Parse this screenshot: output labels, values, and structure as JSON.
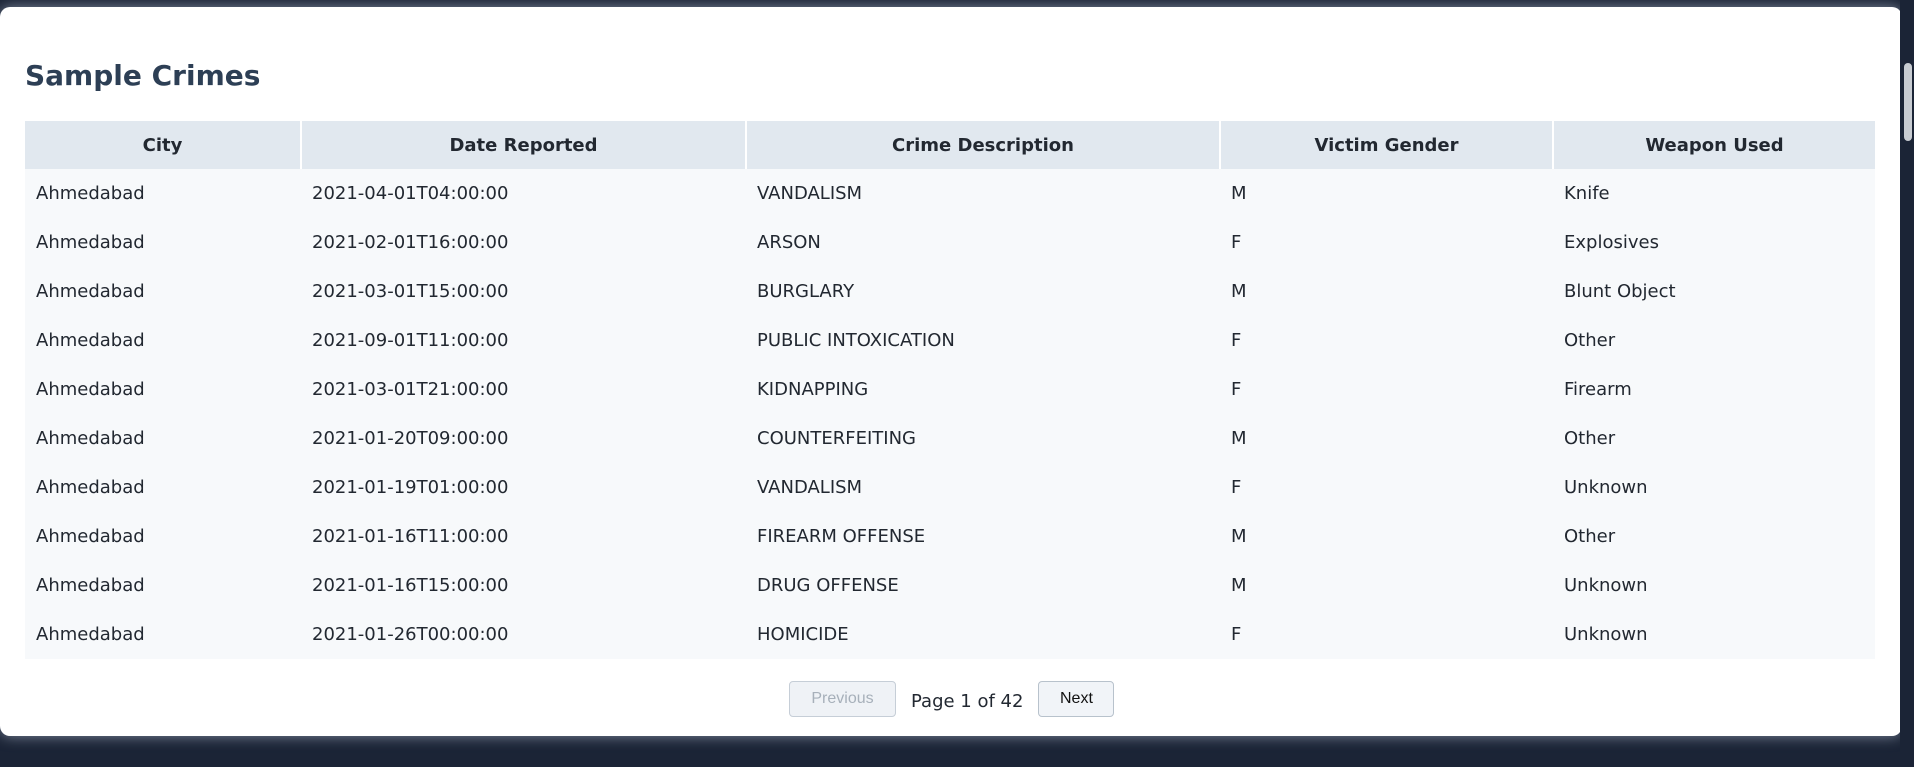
{
  "title": "Sample Crimes",
  "table": {
    "headers": [
      "City",
      "Date Reported",
      "Crime Description",
      "Victim Gender",
      "Weapon Used"
    ],
    "rows": [
      [
        "Ahmedabad",
        "2021-04-01T04:00:00",
        "VANDALISM",
        "M",
        "Knife"
      ],
      [
        "Ahmedabad",
        "2021-02-01T16:00:00",
        "ARSON",
        "F",
        "Explosives"
      ],
      [
        "Ahmedabad",
        "2021-03-01T15:00:00",
        "BURGLARY",
        "M",
        "Blunt Object"
      ],
      [
        "Ahmedabad",
        "2021-09-01T11:00:00",
        "PUBLIC INTOXICATION",
        "F",
        "Other"
      ],
      [
        "Ahmedabad",
        "2021-03-01T21:00:00",
        "KIDNAPPING",
        "F",
        "Firearm"
      ],
      [
        "Ahmedabad",
        "2021-01-20T09:00:00",
        "COUNTERFEITING",
        "M",
        "Other"
      ],
      [
        "Ahmedabad",
        "2021-01-19T01:00:00",
        "VANDALISM",
        "F",
        "Unknown"
      ],
      [
        "Ahmedabad",
        "2021-01-16T11:00:00",
        "FIREARM OFFENSE",
        "M",
        "Other"
      ],
      [
        "Ahmedabad",
        "2021-01-16T15:00:00",
        "DRUG OFFENSE",
        "M",
        "Unknown"
      ],
      [
        "Ahmedabad",
        "2021-01-26T00:00:00",
        "HOMICIDE",
        "F",
        "Unknown"
      ]
    ]
  },
  "pagination": {
    "previous_label": "Previous",
    "page_info": "Page 1 of 42",
    "next_label": "Next"
  }
}
